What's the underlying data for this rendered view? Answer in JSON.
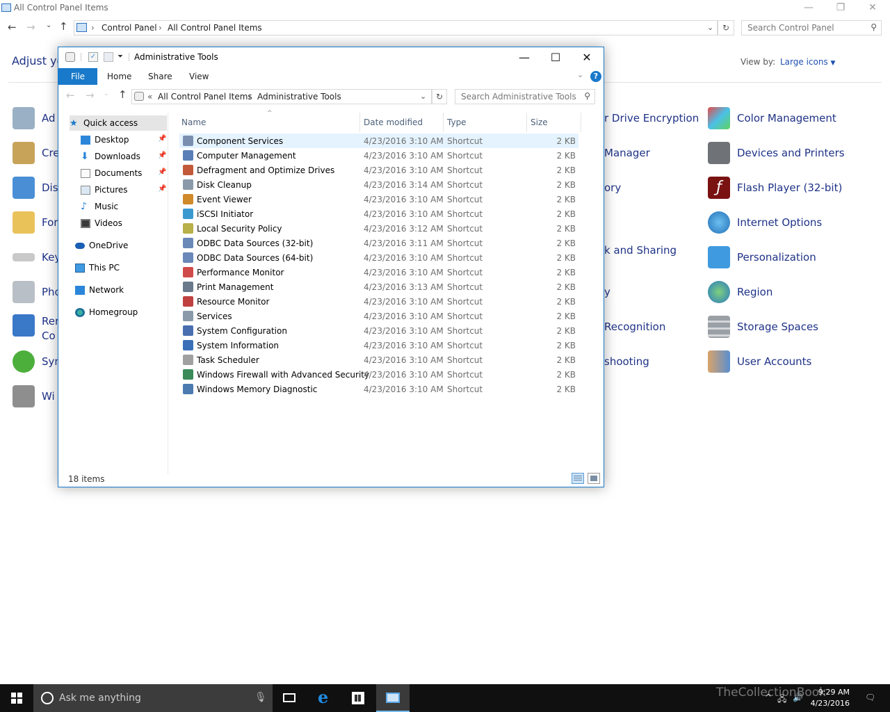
{
  "control_panel": {
    "window_title": "All Control Panel Items",
    "breadcrumb": [
      "Control Panel",
      "All Control Panel Items"
    ],
    "search_placeholder": "Search Control Panel",
    "heading": "Adjust yo",
    "view_by_label": "View by:",
    "view_by_value": "Large icons",
    "left_items": [
      "Ad",
      "Cre",
      "Dis",
      "For",
      "Key",
      "Pho",
      "Rer",
      "Co",
      "Syn",
      "Wi"
    ],
    "middle_items": [
      "r Drive Encryption",
      "Manager",
      "ory",
      "k and Sharing",
      "y",
      "Recognition",
      "shooting"
    ],
    "right_items": [
      {
        "label": "Color Management",
        "icon": "color-management-icon"
      },
      {
        "label": "Devices and Printers",
        "icon": "printer-icon"
      },
      {
        "label": "Flash Player (32-bit)",
        "icon": "flash-icon"
      },
      {
        "label": "Internet Options",
        "icon": "globe-icon"
      },
      {
        "label": "Personalization",
        "icon": "monitor-icon"
      },
      {
        "label": "Region",
        "icon": "region-icon"
      },
      {
        "label": "Storage Spaces",
        "icon": "storage-icon"
      },
      {
        "label": "User Accounts",
        "icon": "users-icon"
      }
    ]
  },
  "explorer": {
    "title": "Administrative Tools",
    "tabs": {
      "file": "File",
      "home": "Home",
      "share": "Share",
      "view": "View"
    },
    "address": {
      "prefix": "«",
      "crumbs": [
        "All Control Panel Items",
        "Administrative Tools"
      ]
    },
    "search_placeholder": "Search Administrative Tools",
    "nav": {
      "quick_access": "Quick access",
      "desktop": "Desktop",
      "downloads": "Downloads",
      "documents": "Documents",
      "pictures": "Pictures",
      "music": "Music",
      "videos": "Videos",
      "onedrive": "OneDrive",
      "this_pc": "This PC",
      "network": "Network",
      "homegroup": "Homegroup"
    },
    "columns": {
      "name": "Name",
      "date": "Date modified",
      "type": "Type",
      "size": "Size"
    },
    "files": [
      {
        "name": "Component Services",
        "date": "4/23/2016 3:10 AM",
        "type": "Shortcut",
        "size": "2 KB"
      },
      {
        "name": "Computer Management",
        "date": "4/23/2016 3:10 AM",
        "type": "Shortcut",
        "size": "2 KB"
      },
      {
        "name": "Defragment and Optimize Drives",
        "date": "4/23/2016 3:10 AM",
        "type": "Shortcut",
        "size": "2 KB"
      },
      {
        "name": "Disk Cleanup",
        "date": "4/23/2016 3:14 AM",
        "type": "Shortcut",
        "size": "2 KB"
      },
      {
        "name": "Event Viewer",
        "date": "4/23/2016 3:10 AM",
        "type": "Shortcut",
        "size": "2 KB"
      },
      {
        "name": "iSCSI Initiator",
        "date": "4/23/2016 3:10 AM",
        "type": "Shortcut",
        "size": "2 KB"
      },
      {
        "name": "Local Security Policy",
        "date": "4/23/2016 3:12 AM",
        "type": "Shortcut",
        "size": "2 KB"
      },
      {
        "name": "ODBC Data Sources (32-bit)",
        "date": "4/23/2016 3:11 AM",
        "type": "Shortcut",
        "size": "2 KB"
      },
      {
        "name": "ODBC Data Sources (64-bit)",
        "date": "4/23/2016 3:10 AM",
        "type": "Shortcut",
        "size": "2 KB"
      },
      {
        "name": "Performance Monitor",
        "date": "4/23/2016 3:10 AM",
        "type": "Shortcut",
        "size": "2 KB"
      },
      {
        "name": "Print Management",
        "date": "4/23/2016 3:13 AM",
        "type": "Shortcut",
        "size": "2 KB"
      },
      {
        "name": "Resource Monitor",
        "date": "4/23/2016 3:10 AM",
        "type": "Shortcut",
        "size": "2 KB"
      },
      {
        "name": "Services",
        "date": "4/23/2016 3:10 AM",
        "type": "Shortcut",
        "size": "2 KB"
      },
      {
        "name": "System Configuration",
        "date": "4/23/2016 3:10 AM",
        "type": "Shortcut",
        "size": "2 KB"
      },
      {
        "name": "System Information",
        "date": "4/23/2016 3:10 AM",
        "type": "Shortcut",
        "size": "2 KB"
      },
      {
        "name": "Task Scheduler",
        "date": "4/23/2016 3:10 AM",
        "type": "Shortcut",
        "size": "2 KB"
      },
      {
        "name": "Windows Firewall with Advanced Security",
        "date": "4/23/2016 3:10 AM",
        "type": "Shortcut",
        "size": "2 KB"
      },
      {
        "name": "Windows Memory Diagnostic",
        "date": "4/23/2016 3:10 AM",
        "type": "Shortcut",
        "size": "2 KB"
      }
    ],
    "status": "18 items"
  },
  "taskbar": {
    "search_placeholder": "Ask me anything",
    "time": "9:29 AM",
    "date": "4/23/2016",
    "watermark": "TheCollectionBook"
  },
  "colors": {
    "accent": "#1979ca",
    "link": "#1e3287",
    "taskbar": "#101010",
    "selection": "#e5f3ff"
  }
}
